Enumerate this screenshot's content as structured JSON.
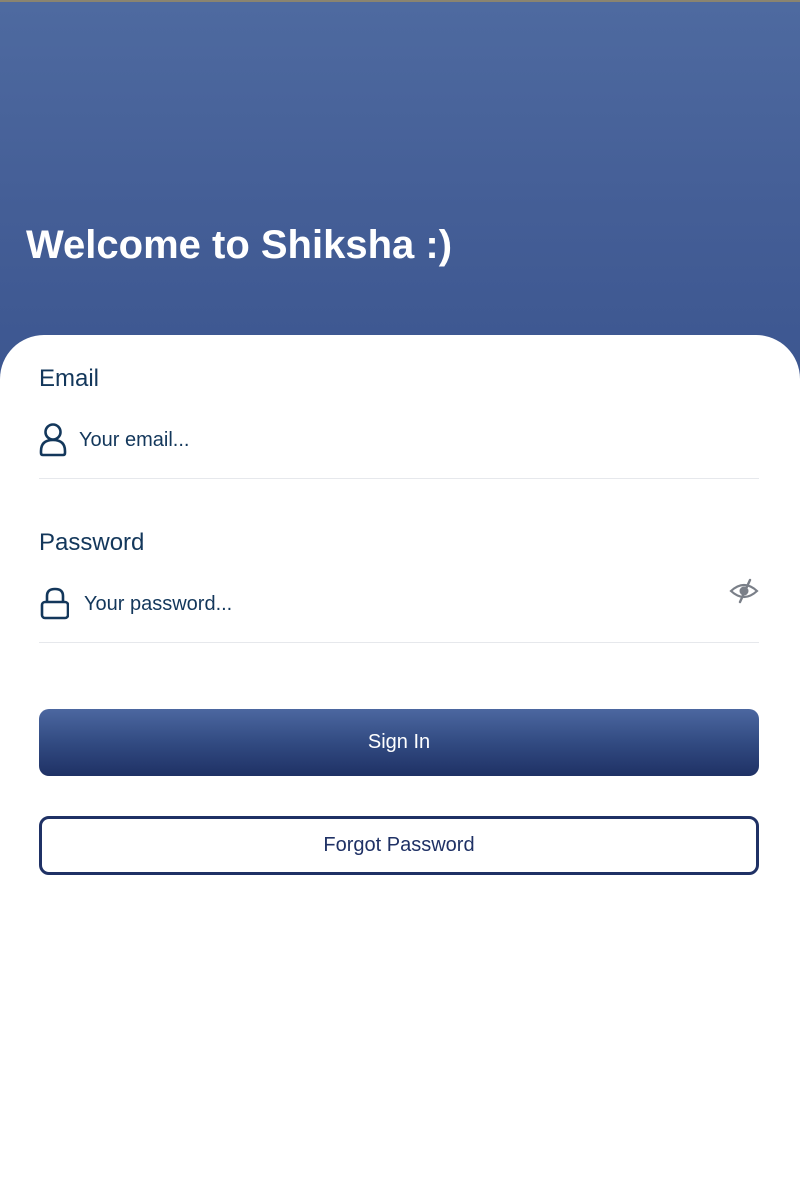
{
  "header": {
    "welcome_text": "Welcome to Shiksha :)"
  },
  "form": {
    "email": {
      "label": "Email",
      "placeholder": "Your email...",
      "value": "",
      "icon": "user-icon"
    },
    "password": {
      "label": "Password",
      "placeholder": "Your password...",
      "value": "",
      "icon": "lock-icon",
      "visibility_icon": "eye-slash-icon"
    }
  },
  "actions": {
    "sign_in_label": "Sign In",
    "forgot_password_label": "Forgot Password"
  },
  "colors": {
    "header_gradient_top": "#4e6aa0",
    "header_gradient_bottom": "#3c5690",
    "primary_dark": "#1f3165",
    "text_dark": "#13375b",
    "divider": "#e6e8ec"
  }
}
